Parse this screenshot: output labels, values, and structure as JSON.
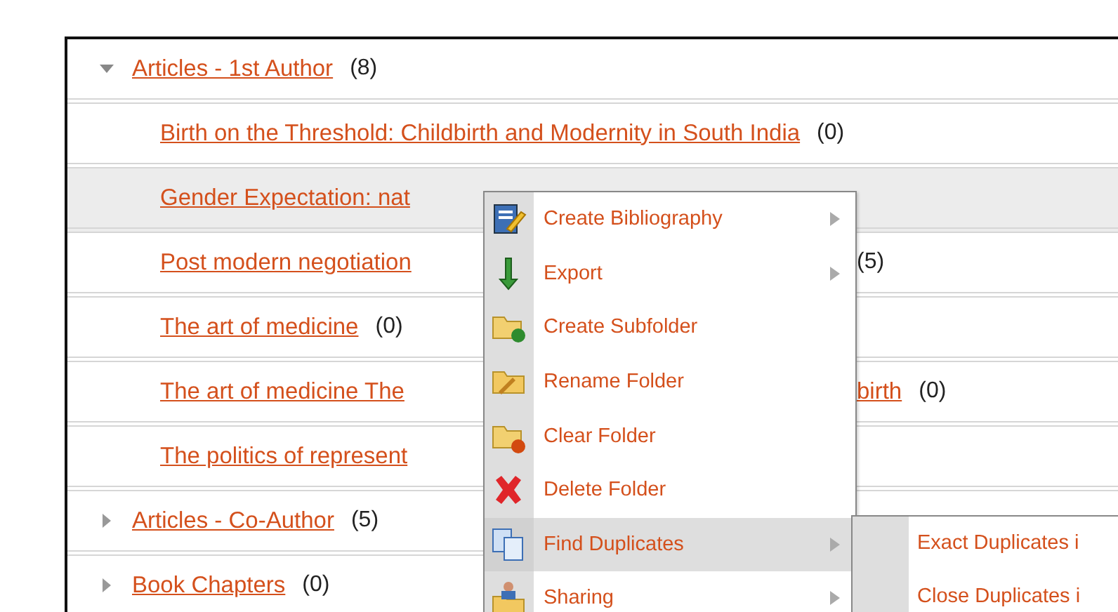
{
  "folders": [
    {
      "name": "Articles - 1st Author",
      "count": "(8)",
      "expanded": true,
      "selected": false,
      "children": [
        {
          "name": "Birth on the Threshold: Childbirth and Modernity in South India",
          "count": "(0)",
          "selected": false
        },
        {
          "name": "Gender Expectation: nat",
          "selected": true
        },
        {
          "name": "Post modern negotiation",
          "selected": false,
          "tail": {
            "count": "(5)"
          }
        },
        {
          "name": "The art of medicine",
          "count": "(0)",
          "selected": false
        },
        {
          "name": "The art of medicine The",
          "selected": false,
          "tail": {
            "name": "birth",
            "count": "(0)"
          }
        },
        {
          "name": "The politics of represent",
          "selected": false
        }
      ]
    },
    {
      "name": "Articles - Co-Author",
      "count": "(5)",
      "expanded": false,
      "selected": false
    },
    {
      "name": "Book Chapters",
      "count": "(0)",
      "expanded": false,
      "selected": false
    }
  ],
  "context_menu": {
    "items": [
      {
        "label": "Create Bibliography",
        "kind": "bibliography",
        "submenu": true,
        "selected": false
      },
      {
        "label": "Export",
        "kind": "export",
        "submenu": true,
        "selected": false
      },
      {
        "label": "Create Subfolder",
        "kind": "subfolder",
        "submenu": false,
        "selected": false
      },
      {
        "label": "Rename Folder",
        "kind": "rename",
        "submenu": false,
        "selected": false
      },
      {
        "label": "Clear Folder",
        "kind": "clear",
        "submenu": false,
        "selected": false
      },
      {
        "label": "Delete Folder",
        "kind": "delete",
        "submenu": false,
        "selected": false
      },
      {
        "label": "Find Duplicates",
        "kind": "duplicates",
        "submenu": true,
        "selected": true
      },
      {
        "label": "Sharing",
        "kind": "sharing",
        "submenu": true,
        "selected": false
      }
    ]
  },
  "submenu": {
    "items": [
      "Exact Duplicates i",
      "Close Duplicates i"
    ]
  }
}
